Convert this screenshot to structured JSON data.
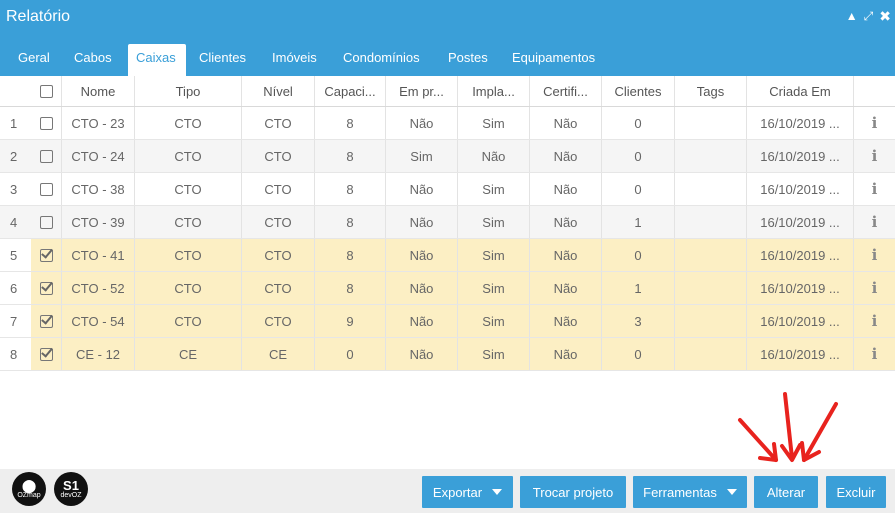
{
  "window": {
    "title": "Relatório"
  },
  "tabs": [
    {
      "label": "Geral",
      "active": false
    },
    {
      "label": "Cabos",
      "active": false
    },
    {
      "label": "Caixas",
      "active": true
    },
    {
      "label": "Clientes",
      "active": false
    },
    {
      "label": "Imóveis",
      "active": false
    },
    {
      "label": "Condomínios",
      "active": false
    },
    {
      "label": "Postes",
      "active": false
    },
    {
      "label": "Equipamentos",
      "active": false
    }
  ],
  "table": {
    "headers": [
      "Nome",
      "Tipo",
      "Nível",
      "Capaci...",
      "Em pr...",
      "Impla...",
      "Certifi...",
      "Clientes",
      "Tags",
      "Criada Em"
    ],
    "rows": [
      {
        "num": "1",
        "checked": false,
        "cells": [
          "CTO - 23",
          "CTO",
          "CTO",
          "8",
          "Não",
          "Sim",
          "Não",
          "0",
          "",
          "16/10/2019 ..."
        ]
      },
      {
        "num": "2",
        "checked": false,
        "cells": [
          "CTO - 24",
          "CTO",
          "CTO",
          "8",
          "Sim",
          "Não",
          "Não",
          "0",
          "",
          "16/10/2019 ..."
        ]
      },
      {
        "num": "3",
        "checked": false,
        "cells": [
          "CTO - 38",
          "CTO",
          "CTO",
          "8",
          "Não",
          "Sim",
          "Não",
          "0",
          "",
          "16/10/2019 ..."
        ]
      },
      {
        "num": "4",
        "checked": false,
        "cells": [
          "CTO - 39",
          "CTO",
          "CTO",
          "8",
          "Não",
          "Sim",
          "Não",
          "1",
          "",
          "16/10/2019 ..."
        ]
      },
      {
        "num": "5",
        "checked": true,
        "cells": [
          "CTO - 41",
          "CTO",
          "CTO",
          "8",
          "Não",
          "Sim",
          "Não",
          "0",
          "",
          "16/10/2019 ..."
        ]
      },
      {
        "num": "6",
        "checked": true,
        "cells": [
          "CTO - 52",
          "CTO",
          "CTO",
          "8",
          "Não",
          "Sim",
          "Não",
          "1",
          "",
          "16/10/2019 ..."
        ]
      },
      {
        "num": "7",
        "checked": true,
        "cells": [
          "CTO - 54",
          "CTO",
          "CTO",
          "9",
          "Não",
          "Sim",
          "Não",
          "3",
          "",
          "16/10/2019 ..."
        ]
      },
      {
        "num": "8",
        "checked": true,
        "cells": [
          "CE - 12",
          "CE",
          "CE",
          "0",
          "Não",
          "Sim",
          "Não",
          "0",
          "",
          "16/10/2019 ..."
        ]
      }
    ]
  },
  "footer": {
    "logos": [
      {
        "top": "",
        "bottom": "OZmap"
      },
      {
        "top": "S1",
        "bottom": "devOZ"
      }
    ],
    "buttons": {
      "exportar": "Exportar",
      "trocar_projeto": "Trocar projeto",
      "ferramentas": "Ferramentas",
      "alterar": "Alterar",
      "excluir": "Excluir"
    }
  },
  "colors": {
    "accent": "#3a9fd8",
    "selected_row": "#fcefc4",
    "annotation": "#e8231e"
  },
  "icons": [
    "caret-up-icon",
    "expand-icon",
    "close-icon",
    "checkbox-icon",
    "info-icon",
    "dropdown-caret-icon",
    "annotation-arrows"
  ]
}
